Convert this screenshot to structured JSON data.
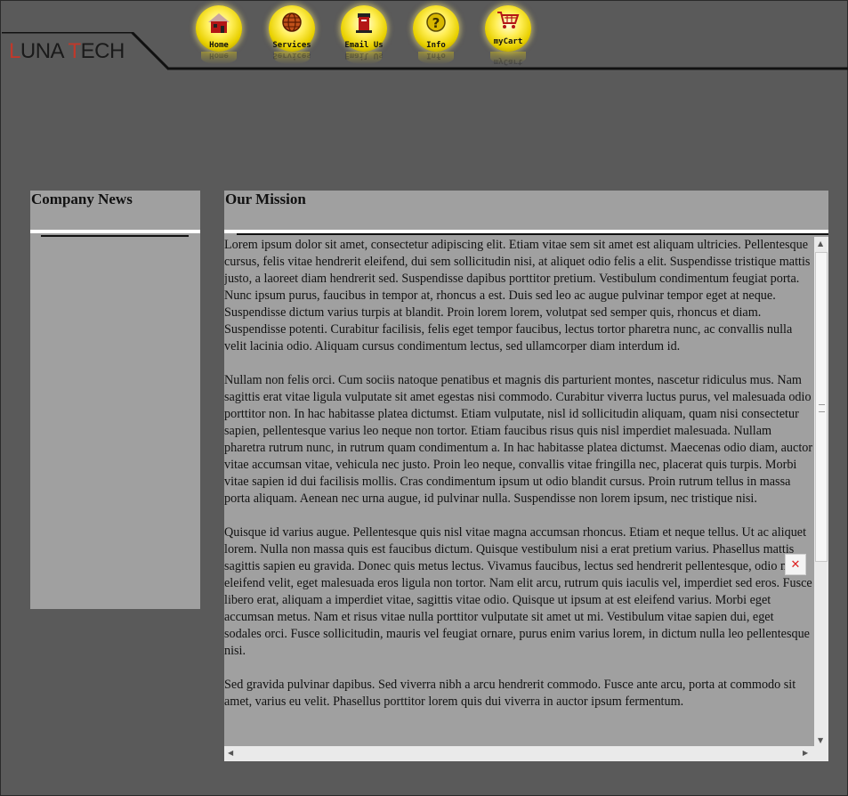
{
  "logo": {
    "first_letter": "L",
    "part1": "UNA ",
    "accent2": "T",
    "part2": "ECH"
  },
  "nav": [
    {
      "label": "Home",
      "icon": "house-icon"
    },
    {
      "label": "Services",
      "icon": "globe-icon"
    },
    {
      "label": "Email Us",
      "icon": "mailbox-icon"
    },
    {
      "label": "Info",
      "icon": "question-icon"
    },
    {
      "label": "myCart",
      "icon": "cart-icon"
    }
  ],
  "news": {
    "title": "Company News"
  },
  "mission": {
    "title": "Our Mission",
    "paragraphs": [
      "Lorem ipsum dolor sit amet, consectetur adipiscing elit. Etiam vitae sem sit amet est aliquam ultricies. Pellentesque cursus, felis vitae hendrerit eleifend, dui sem sollicitudin nisi, at aliquet odio felis a elit. Suspendisse tristique mattis justo, a laoreet diam hendrerit sed. Suspendisse dapibus porttitor pretium. Vestibulum condimentum feugiat porta. Nunc ipsum purus, faucibus in tempor at, rhoncus a est. Duis sed leo ac augue pulvinar tempor eget at neque. Suspendisse dictum varius turpis at blandit. Proin lorem lorem, volutpat sed semper quis, rhoncus et diam. Suspendisse potenti. Curabitur facilisis, felis eget tempor faucibus, lectus tortor pharetra nunc, ac convallis nulla velit lacinia odio. Aliquam cursus condimentum lectus, sed ullamcorper diam interdum id.",
      "Nullam non felis orci. Cum sociis natoque penatibus et magnis dis parturient montes, nascetur ridiculus mus. Nam sagittis erat vitae ligula vulputate sit amet egestas nisi commodo. Curabitur viverra luctus purus, vel malesuada odio porttitor non. In hac habitasse platea dictumst. Etiam vulputate, nisl id sollicitudin aliquam, quam nisi consectetur sapien, pellentesque varius leo neque non tortor. Etiam faucibus risus quis nisl imperdiet malesuada. Nullam pharetra rutrum nunc, in rutrum quam condimentum a. In hac habitasse platea dictumst. Maecenas odio diam, auctor vitae accumsan vitae, vehicula nec justo. Proin leo neque, convallis vitae fringilla nec, placerat quis turpis. Morbi vitae sapien id dui facilisis mollis. Cras condimentum ipsum ut odio blandit cursus. Proin rutrum tellus in massa porta aliquam. Aenean nec urna augue, id pulvinar nulla. Suspendisse non lorem ipsum, nec tristique nisi.",
      "Quisque id varius augue. Pellentesque quis nisl vitae magna accumsan rhoncus. Etiam et neque tellus. Ut ac aliquet lorem. Nulla non massa quis est faucibus dictum. Quisque vestibulum nisi a erat pretium varius. Phasellus mattis sagittis sapien eu gravida. Donec quis metus lectus. Vivamus faucibus, lectus sed hendrerit pellentesque, odio nisl eleifend velit, eget malesuada eros ligula non tortor. Nam elit arcu, rutrum quis iaculis vel, imperdiet sed eros. Fusce libero erat, aliquam a imperdiet vitae, sagittis vitae odio. Quisque ut ipsum at est eleifend varius. Morbi eget accumsan metus. Nam et risus vitae nulla porttitor vulputate sit amet ut mi. Vestibulum vitae sapien dui, eget sodales orci. Fusce sollicitudin, mauris vel feugiat ornare, purus enim varius lorem, in dictum nulla leo pellentesque nisi.",
      "Sed gravida pulvinar dapibus. Sed viverra nibh a arcu hendrerit commodo. Fusce ante arcu, porta at commodo sit amet, varius eu velit. Phasellus porttitor lorem quis dui viverra in auctor ipsum fermentum."
    ]
  },
  "colors": {
    "background": "#5a5a5a",
    "panel": "#a0a0a0",
    "accent": "#c0392b",
    "orb": "#ffee55"
  }
}
